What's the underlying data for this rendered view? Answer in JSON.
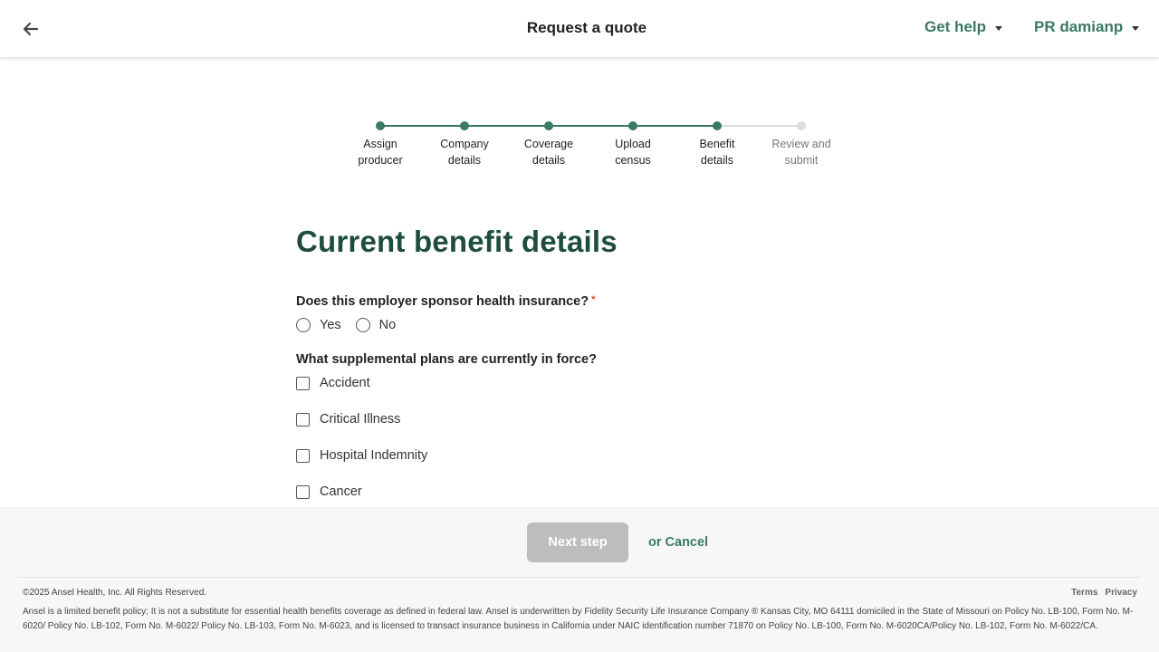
{
  "header": {
    "title": "Request a quote",
    "help_label": "Get help",
    "user_label": "PR damianp"
  },
  "stepper": {
    "steps": [
      {
        "label_line1": "Assign",
        "label_line2": "producer",
        "state": "done"
      },
      {
        "label_line1": "Company",
        "label_line2": "details",
        "state": "done"
      },
      {
        "label_line1": "Coverage",
        "label_line2": "details",
        "state": "done"
      },
      {
        "label_line1": "Upload",
        "label_line2": "census",
        "state": "done"
      },
      {
        "label_line1": "Benefit",
        "label_line2": "details",
        "state": "current"
      },
      {
        "label_line1": "Review and",
        "label_line2": "submit",
        "state": "todo"
      }
    ]
  },
  "form": {
    "title": "Current benefit details",
    "q1": {
      "label": "Does this employer sponsor health insurance?",
      "required_mark": "*",
      "options": [
        "Yes",
        "No"
      ]
    },
    "q2": {
      "label": "What supplemental plans are currently in force?",
      "options": [
        "Accident",
        "Critical Illness",
        "Hospital Indemnity",
        "Cancer"
      ]
    }
  },
  "footer": {
    "next_label": "Next step",
    "cancel_label": "or Cancel",
    "copyright": "©2025 Ansel Health, Inc. All Rights Reserved.",
    "links": [
      "Terms",
      "Privacy"
    ],
    "disclaimer": "Ansel is a limited benefit policy; It is not a substitute for essential health benefits coverage as defined in federal law. Ansel is underwritten by Fidelity Security Life Insurance Company ® Kansas City, MO 64111 domiciled in the State of Missouri on Policy No. LB-100, Form No. M-6020/ Policy No. LB-102, Form No. M-6022/ Policy No. LB-103, Form No. M-6023, and is licensed to transact insurance business in California under NAIC identification number 71870 on Policy No. LB-100, Form No. M-6020CA/Policy No. LB-102, Form No. M-6022/CA."
  },
  "colors": {
    "brand_green": "#3a7a60",
    "heading_green": "#1f4d3c",
    "disabled_button": "#bdbdbd",
    "required_red": "#d9432f"
  }
}
